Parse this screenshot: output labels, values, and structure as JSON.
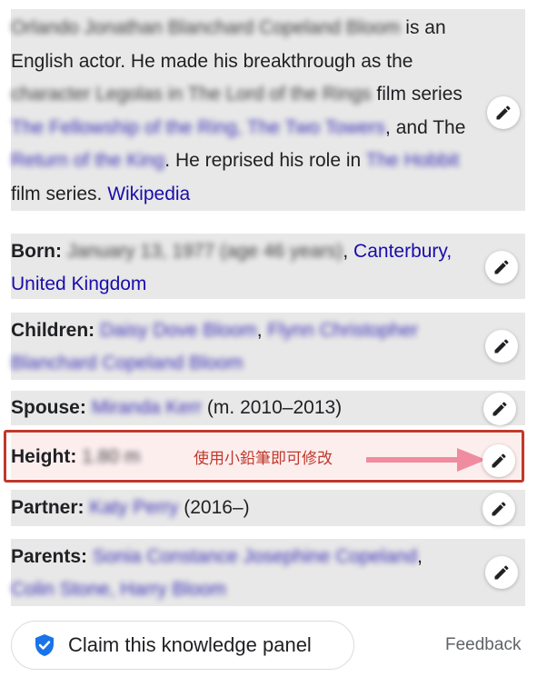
{
  "description": {
    "name_blurred": "Orlando Jonathan Blanchard Copeland Bloom",
    "t1": " is an",
    "t2": "English actor. He made his breakthrough as the",
    "role_blurred": "character Legolas in The Lord of the Rings",
    "t3": " film series",
    "films_blurred": "The Fellowship of the Ring, The Two Towers",
    "t4": ", and The",
    "film3_blurred": "Return of the King",
    "t5": ". He reprised his role in ",
    "hobbit_blurred": "The Hobbit",
    "t6": "film series. ",
    "source_link": "Wikipedia"
  },
  "born": {
    "label": "Born:",
    "date_blurred": "January 13, 1977 (age 46 years)",
    "comma": ", ",
    "place_link_1": "Canterbury,",
    "place_link_2": "United Kingdom"
  },
  "children": {
    "label": "Children:",
    "child1_blurred": "Daisy Dove Bloom",
    "comma": ", ",
    "child2_blurred_a": "Flynn Christopher",
    "child2_blurred_b": "Blanchard Copeland Bloom"
  },
  "spouse": {
    "label": "Spouse:",
    "name_blurred": "Miranda Kerr",
    "years": " (m. 2010–2013)"
  },
  "height": {
    "label": "Height:",
    "value_blurred": "1.80 m",
    "annotation": "使用小鉛筆即可修改"
  },
  "partner": {
    "label": "Partner:",
    "name_blurred": "Katy Perry",
    "years": " (2016–)"
  },
  "parents": {
    "label": "Parents:",
    "line1_blurred": "Sonia Constance Josephine Copeland",
    "comma": ",",
    "line2_blurred": "Colin Stone, Harry Bloom"
  },
  "footer": {
    "claim_label": "Claim this knowledge panel",
    "feedback_label": "Feedback"
  },
  "colors": {
    "panel_bg": "#e8e8e8",
    "link": "#1a0dab",
    "highlight": "#c0392b",
    "arrow": "#f08ca0",
    "shield": "#1a73e8"
  }
}
